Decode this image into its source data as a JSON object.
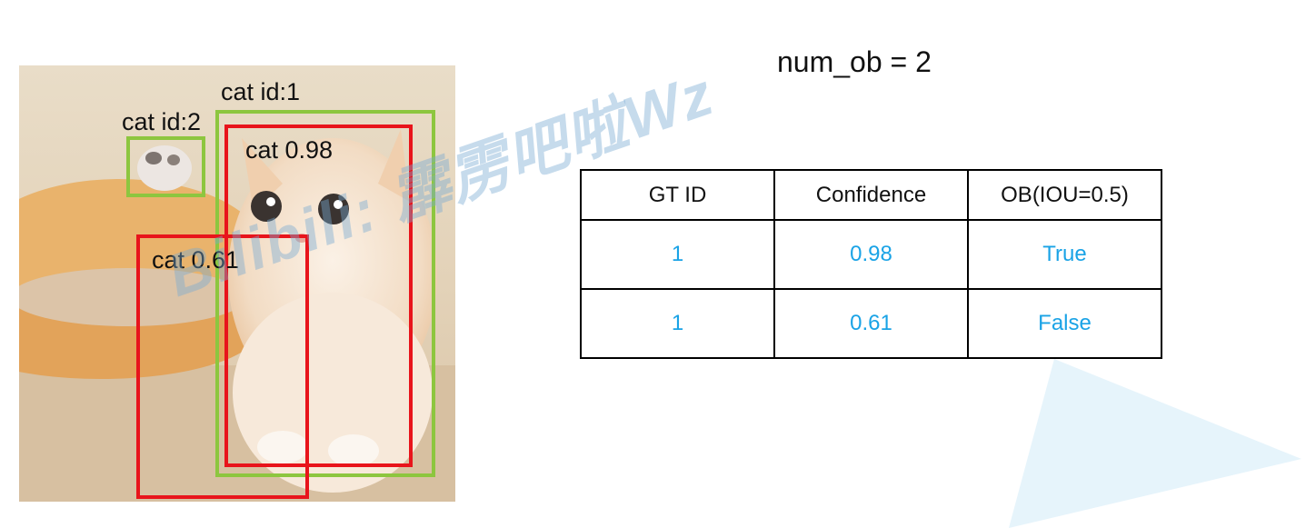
{
  "labels": {
    "gt_box_1": "cat id:1",
    "gt_box_2": "cat id:2",
    "pred_box_1": "cat 0.98",
    "pred_box_2": "cat 0.61"
  },
  "num_ob": "num_ob = 2",
  "table": {
    "headers": [
      "GT ID",
      "Confidence",
      "OB(IOU=0.5)"
    ],
    "rows": [
      [
        "1",
        "0.98",
        "True"
      ],
      [
        "1",
        "0.61",
        "False"
      ]
    ]
  },
  "watermark": "Bilibili: 霹雳吧啦Wz",
  "colors": {
    "gt_box": "#8dc63f",
    "pred_box": "#e8141b",
    "cell_text": "#1aa3e6",
    "decoration": "#e3f3fb"
  }
}
